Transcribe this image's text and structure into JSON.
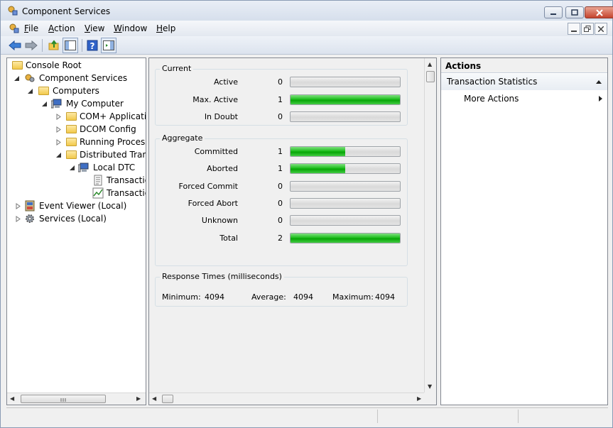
{
  "window": {
    "title": "Component Services"
  },
  "menu": {
    "items": [
      "File",
      "Action",
      "View",
      "Window",
      "Help"
    ],
    "underline": [
      "F",
      "A",
      "V",
      "W",
      "H"
    ]
  },
  "tree": {
    "items": [
      {
        "label": "Console Root",
        "level": 0,
        "icon": "folder-icon"
      },
      {
        "label": "Component Services",
        "level": 1,
        "icon": "component-services-icon",
        "expanded": true
      },
      {
        "label": "Computers",
        "level": 2,
        "icon": "folder-icon",
        "expanded": true
      },
      {
        "label": "My Computer",
        "level": 3,
        "icon": "computer-icon",
        "expanded": true
      },
      {
        "label": "COM+ Applicatio",
        "level": 4,
        "icon": "folder-icon",
        "expanded": false
      },
      {
        "label": "DCOM Config",
        "level": 4,
        "icon": "folder-icon",
        "expanded": false
      },
      {
        "label": "Running Processe",
        "level": 4,
        "icon": "folder-icon",
        "expanded": false
      },
      {
        "label": "Distributed Transa",
        "level": 4,
        "icon": "folder-icon",
        "expanded": true
      },
      {
        "label": "Local DTC",
        "level": 5,
        "icon": "computer-icon",
        "expanded": true
      },
      {
        "label": "Transactio",
        "level": 6,
        "icon": "document-icon"
      },
      {
        "label": "Transactio",
        "level": 6,
        "icon": "chart-icon",
        "selected": true
      },
      {
        "label": "Event Viewer (Local)",
        "level": 1,
        "icon": "event-viewer-icon",
        "expanded": false
      },
      {
        "label": "Services (Local)",
        "level": 1,
        "icon": "gear-icon",
        "expanded": false
      }
    ]
  },
  "stats": {
    "current": {
      "title": "Current",
      "rows": [
        {
          "label": "Active",
          "value": "0",
          "fill": 0
        },
        {
          "label": "Max. Active",
          "value": "1",
          "fill": 1
        },
        {
          "label": "In Doubt",
          "value": "0",
          "fill": 0
        }
      ]
    },
    "aggregate": {
      "title": "Aggregate",
      "rows": [
        {
          "label": "Committed",
          "value": "1",
          "fill": 0.5
        },
        {
          "label": "Aborted",
          "value": "1",
          "fill": 0.5
        },
        {
          "label": "Forced Commit",
          "value": "0",
          "fill": 0
        },
        {
          "label": "Forced Abort",
          "value": "0",
          "fill": 0
        },
        {
          "label": "Unknown",
          "value": "0",
          "fill": 0
        },
        {
          "label": "Total",
          "value": "2",
          "fill": 1
        }
      ]
    },
    "response": {
      "title": "Response Times (milliseconds)",
      "minimum_label": "Minimum:",
      "minimum": "4094",
      "average_label": "Average:",
      "average": "4094",
      "maximum_label": "Maximum:",
      "maximum": "4094"
    }
  },
  "actions": {
    "header": "Actions",
    "section": "Transaction Statistics",
    "more": "More Actions"
  },
  "colors": {
    "bar_fill": "#12b312",
    "selection": "#ffffff",
    "window_border": "#8a9bb5"
  }
}
